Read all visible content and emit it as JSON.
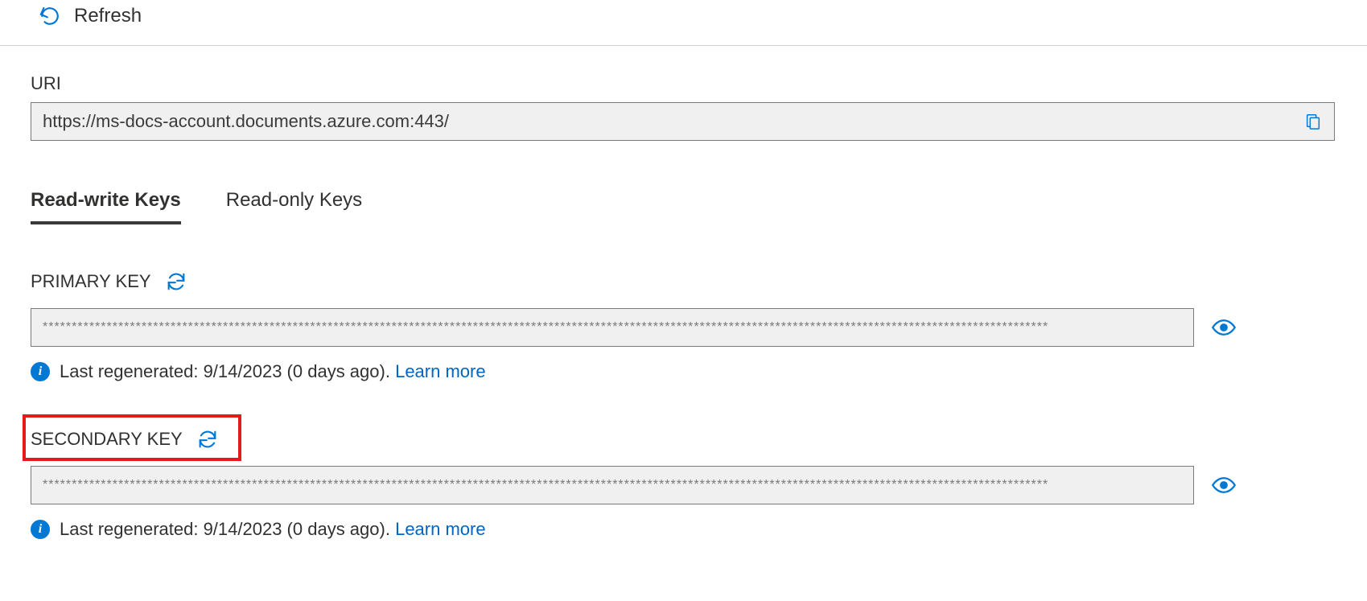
{
  "toolbar": {
    "refresh_label": "Refresh"
  },
  "uri": {
    "label": "URI",
    "value": "https://ms-docs-account.documents.azure.com:443/"
  },
  "tabs": {
    "read_write": "Read-write Keys",
    "read_only": "Read-only Keys"
  },
  "primary": {
    "heading": "PRIMARY KEY",
    "value": "*****************************************************************************************************************************************************************************",
    "info_text": "Last regenerated: 9/14/2023 (0 days ago). ",
    "learn_more": "Learn more"
  },
  "secondary": {
    "heading": "SECONDARY KEY",
    "value": "*****************************************************************************************************************************************************************************",
    "info_text": "Last regenerated: 9/14/2023 (0 days ago). ",
    "learn_more": "Learn more"
  },
  "icons": {
    "refresh": "refresh-icon",
    "copy": "copy-icon",
    "regenerate": "regenerate-icon",
    "show": "eye-icon",
    "info": "info-icon"
  },
  "colors": {
    "accent": "#0078d4",
    "highlight_border": "#e31b1b"
  }
}
